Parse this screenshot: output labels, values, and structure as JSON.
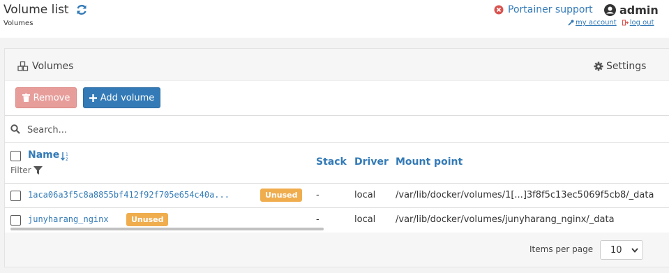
{
  "header": {
    "title": "Volume list",
    "breadcrumb": "Volumes",
    "support_label": "Portainer support",
    "user": "admin",
    "my_account": "my account",
    "log_out": "log out"
  },
  "panel": {
    "title": "Volumes",
    "settings_label": "Settings",
    "remove_label": "Remove",
    "add_label": "Add volume",
    "search_placeholder": "Search...",
    "columns": {
      "name": "Name",
      "filter": "Filter",
      "stack": "Stack",
      "driver": "Driver",
      "mount": "Mount point"
    },
    "rows": [
      {
        "name": "1aca06a3f5c8a8855bf412f92f705e654c40a...",
        "badge": "Unused",
        "stack": "-",
        "driver": "local",
        "mount": "/var/lib/docker/volumes/1[...]3f8f5c13ec5069f5cb8/_data"
      },
      {
        "name": "junyharang_nginx",
        "badge": "Unused",
        "stack": "-",
        "driver": "local",
        "mount": "/var/lib/docker/volumes/junyharang_nginx/_data"
      }
    ],
    "items_per_page_label": "Items per page",
    "items_per_page_value": "10"
  },
  "colors": {
    "primary": "#337ab7",
    "danger_disabled": "#e79e9b",
    "warning": "#f0ad4e",
    "support_icon": "#d9534f"
  }
}
